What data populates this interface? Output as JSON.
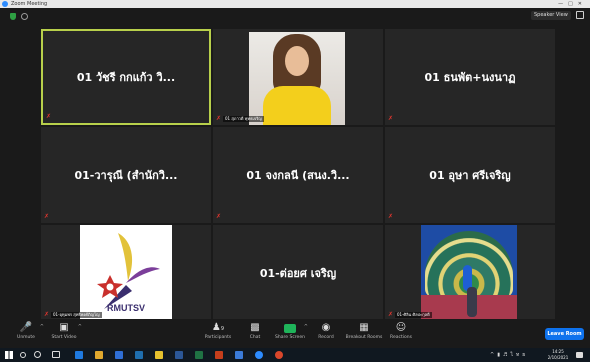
{
  "window": {
    "title": "Zoom Meeting"
  },
  "top_bar": {
    "speaker_view_label": "Speaker View"
  },
  "tiles": [
    {
      "name": "01 วัชรี กกแก้ว วิ..."
    },
    {
      "label": "01 สุภาวดี พุทธเจริญ"
    },
    {
      "name": "01 ธนพัต+นงนาฏ"
    },
    {
      "name": "01-วารุณี (สำนักวิ..."
    },
    {
      "name": "01 จงกลนี (สนง.วิ..."
    },
    {
      "name": "01 อุษา ศรีเจริญ"
    },
    {
      "label": "01-อุทุมพร สุทธิพงศ์ภิญโญ",
      "logo_text": "RMUTSV"
    },
    {
      "name": "01-ต่อยศ เจริญ"
    },
    {
      "label": "01-ศิลิน ศิลปะกุลดี"
    }
  ],
  "toolbar": {
    "unmute": "Unmute",
    "start_video": "Start Video",
    "participants": "Participants",
    "participants_count": "9",
    "chat": "Chat",
    "share_screen": "Share Screen",
    "record": "Record",
    "breakout_rooms": "Breakout Rooms",
    "reactions": "Reactions",
    "leave_room": "Leave Room"
  },
  "taskbar": {
    "time": "14:25",
    "date": "2/10/2021",
    "language": "ไทย"
  },
  "colors": {
    "active_speaker_border": "#b8d04b",
    "leave_button": "#0e72ed",
    "share_screen": "#1fb45a",
    "muted": "#e0362f"
  }
}
